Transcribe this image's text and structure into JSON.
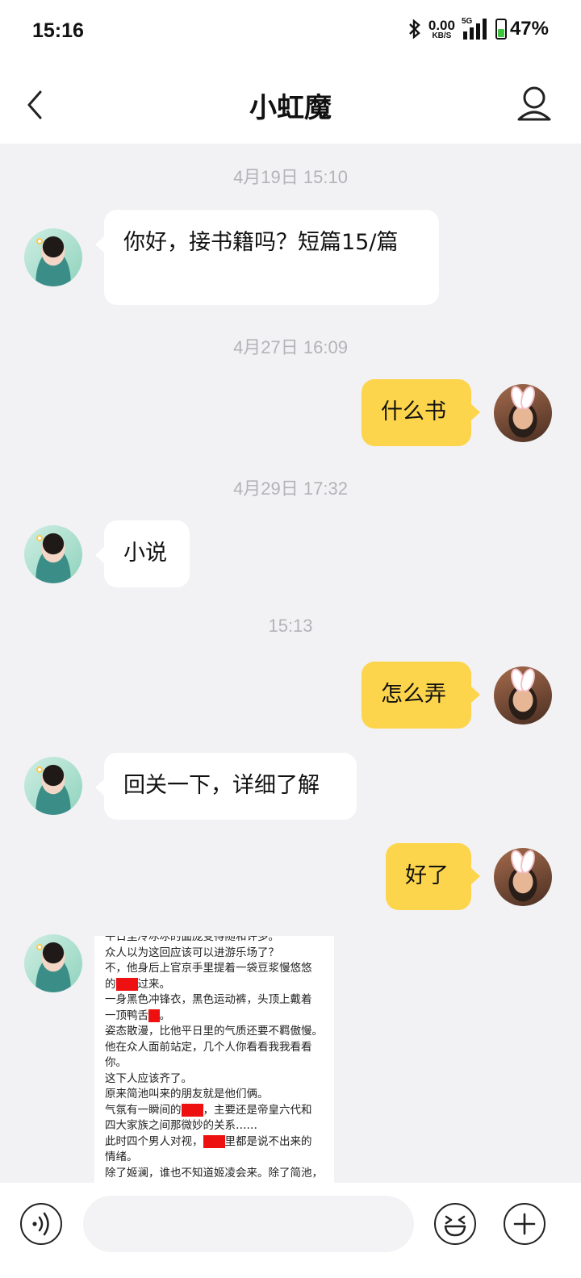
{
  "status_bar": {
    "time": "15:16",
    "net_speed": "0.00",
    "net_unit": "KB/S",
    "network": "5G",
    "battery": "47%",
    "battery_level": 0.47
  },
  "header": {
    "title": "小虹魔",
    "back_icon": "chevron-left-icon",
    "profile_icon": "person-icon"
  },
  "messages": [
    {
      "type": "time",
      "text": "4月19日 15:10"
    },
    {
      "type": "text",
      "side": "left",
      "text": "你好，接书籍吗？短篇15/篇"
    },
    {
      "type": "time",
      "text": "4月27日 16:09"
    },
    {
      "type": "text",
      "side": "right",
      "text": "什么书"
    },
    {
      "type": "time",
      "text": "4月29日 17:32"
    },
    {
      "type": "text",
      "side": "left",
      "text": "小说"
    },
    {
      "type": "time",
      "text": "15:13"
    },
    {
      "type": "text",
      "side": "right",
      "text": "怎么弄"
    },
    {
      "type": "text",
      "side": "left",
      "text": "回关一下，详细了解"
    },
    {
      "type": "text",
      "side": "right",
      "text": "好了"
    },
    {
      "type": "image",
      "side": "left",
      "lines": [
        "平日里冷冰冰的面庞变得随和许多。",
        "众人以为这回应该可以进游乐场了？",
        "不，他身后上官京手里提着一袋豆浆慢悠悠",
        "过来。",
        "一身黑色冲锋衣，黑色运动裤，头顶上戴着",
        "一顶鸭舌",
        "。",
        "姿态散漫，比他平日里的气质还要不羁傲慢。",
        "他在众人面前站定，几个人你看看我我看看",
        "你。",
        "这下人应该齐了。",
        "原来简池叫来的朋友就是他们俩。",
        "气氛有一瞬间的",
        "，主要还是帝皇六代和",
        "四大家族之间那微妙的关系……",
        "此时四个男人对视，",
        "里都是说不出来的",
        "情绪。",
        "除了姬澜，谁也不知道姬凌会来。除了简池，"
      ]
    }
  ],
  "input_bar": {
    "voice_icon": "voice-icon",
    "emoji_icon": "emoji-icon",
    "plus_icon": "plus-icon",
    "placeholder": ""
  }
}
